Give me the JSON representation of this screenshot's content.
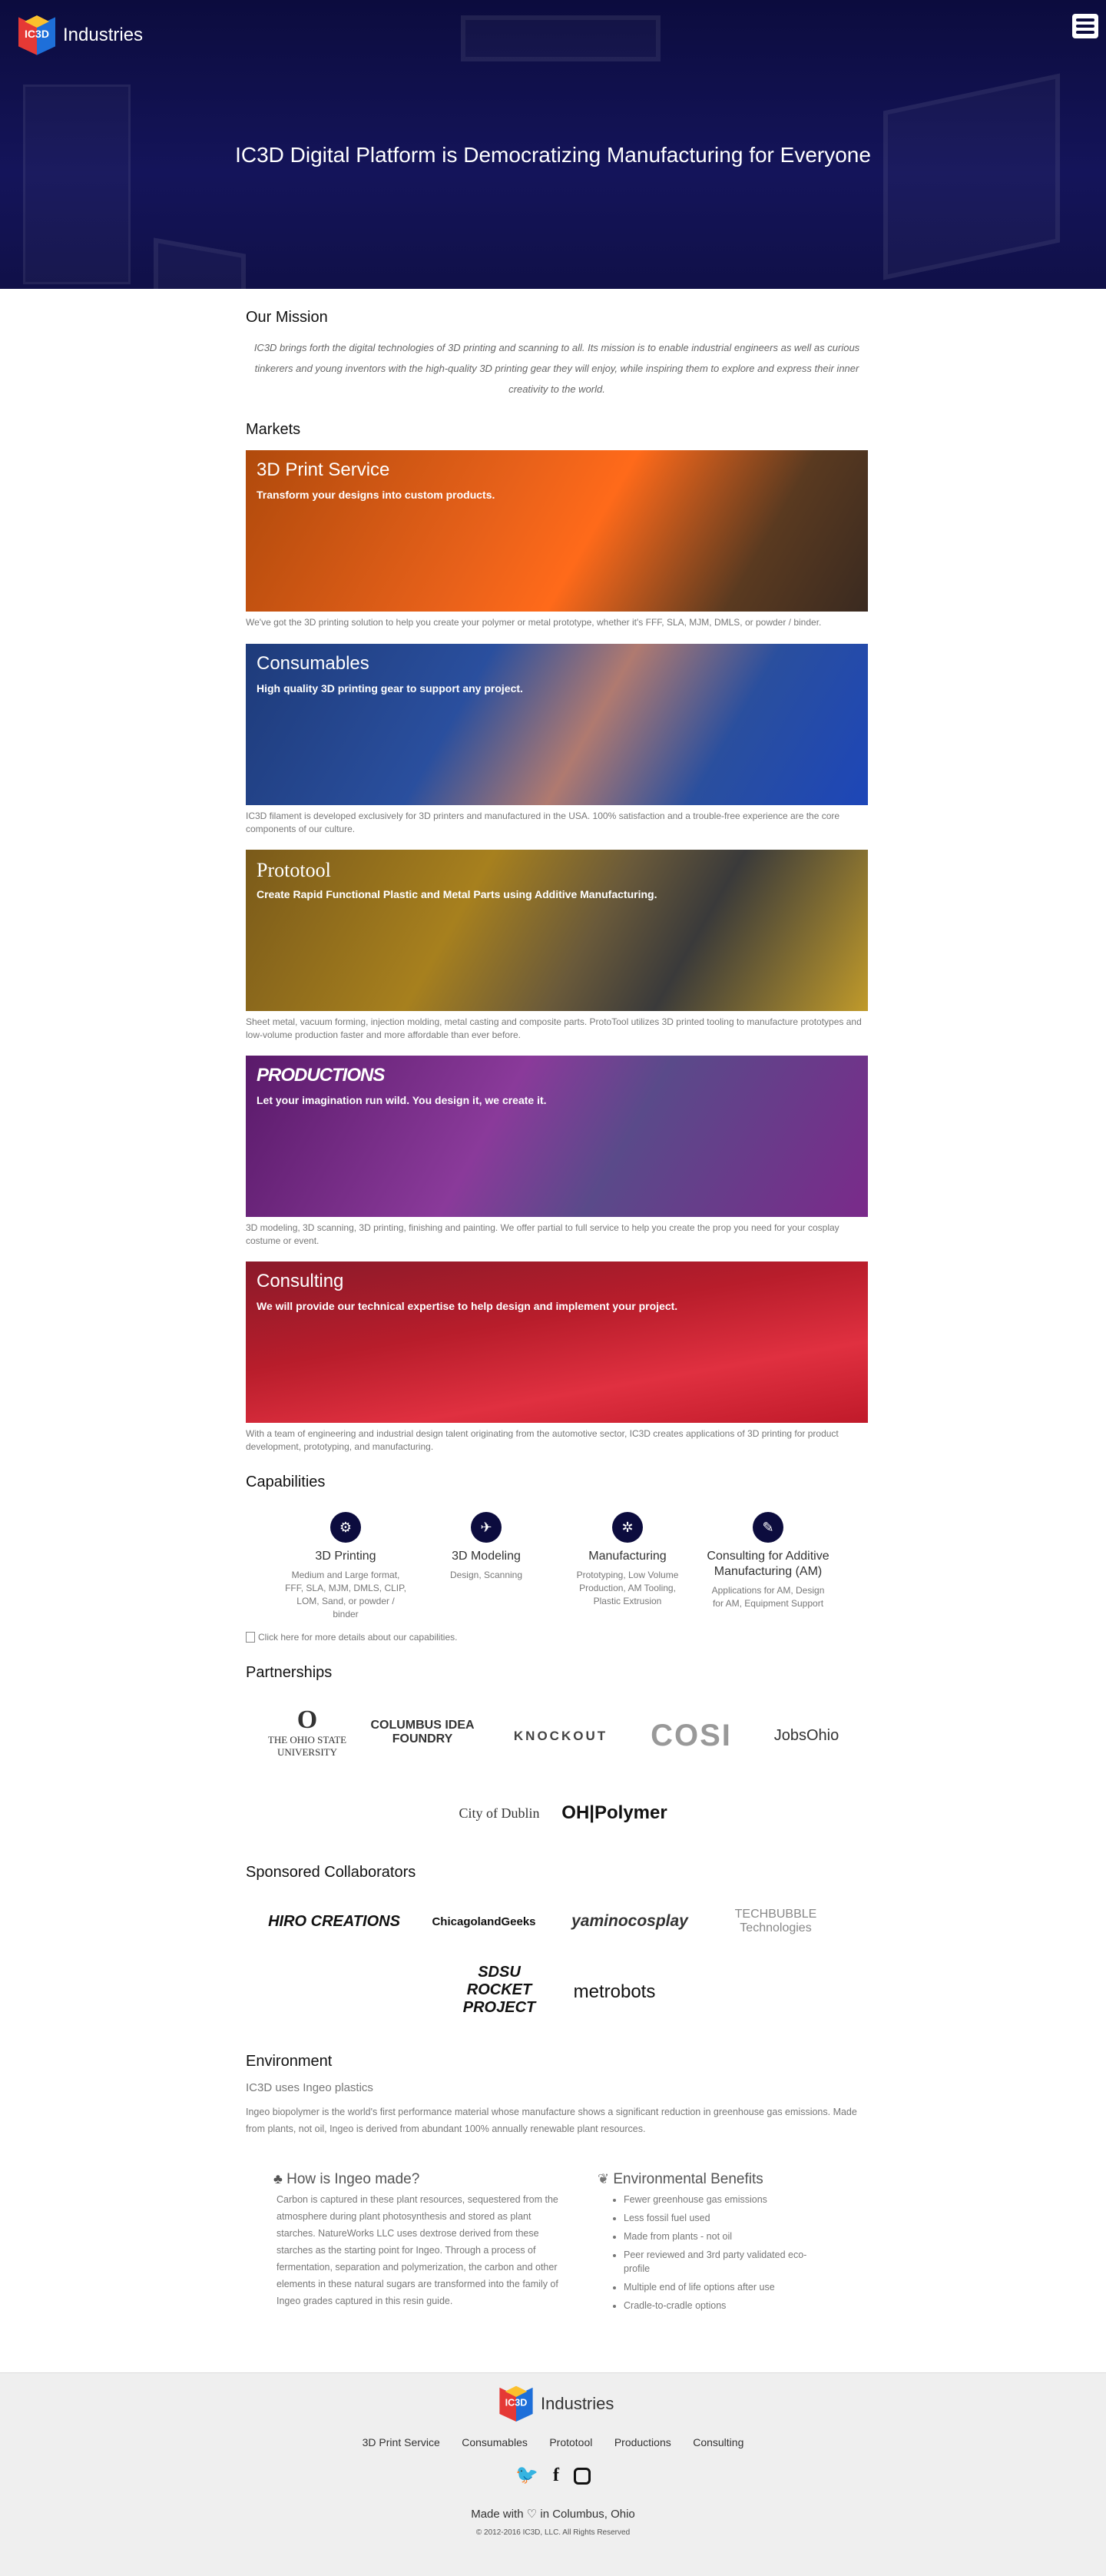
{
  "header": {
    "brand_glyph": "IC3D",
    "brand_text": "Industries",
    "hero_title": "IC3D Digital Platform is Democratizing Manufacturing for Everyone",
    "menu_icon": "hamburger-icon"
  },
  "mission": {
    "title": "Our Mission",
    "text": "IC3D brings forth the digital technologies of 3D printing and scanning to all. Its mission is to enable industrial engineers as well as curious tinkerers and young inventors with the high-quality 3D printing gear they will enjoy, while inspiring them to explore and express their inner creativity to the world."
  },
  "markets": {
    "title": "Markets",
    "items": [
      {
        "title": "3D Print Service",
        "subtitle": "Transform your designs into custom products.",
        "desc": "We've got the 3D printing solution to help you create your polymer or metal prototype, whether it's FFF, SLA, MJM, DMLS, or powder / binder.",
        "color": "#e8611a"
      },
      {
        "title": "Consumables",
        "subtitle": "High quality 3D printing gear to support any project.",
        "desc": "IC3D filament is developed exclusively for 3D printers and manufactured in the USA. 100% satisfaction and a trouble-free experience are the core components of our culture.",
        "color": "#2a4f9e"
      },
      {
        "title": "Prototool",
        "subtitle": "Create Rapid Functional Plastic and Metal Parts using Additive Manufacturing.",
        "desc": "Sheet metal, vacuum forming, injection molding, metal casting and composite parts. ProtoTool utilizes 3D printed tooling to manufacture prototypes and low-volume production faster and more affordable than ever before.",
        "color": "#a7801e"
      },
      {
        "title": "PRODUCTIONS",
        "subtitle": "Let your imagination run wild. You design it, we create it.",
        "desc": "3D modeling, 3D scanning, 3D printing, finishing and painting. We offer partial to full service to help you create the prop you need for your cosplay costume or event.",
        "color": "#7a2a8a"
      },
      {
        "title": "Consulting",
        "subtitle": "We will provide our technical expertise to help design and implement your project.",
        "desc": "With a team of engineering and industrial design talent originating from the automotive sector, IC3D creates applications of 3D printing for product development, prototyping, and manufacturing.",
        "color": "#b81d2b"
      }
    ]
  },
  "capabilities": {
    "title": "Capabilities",
    "items": [
      {
        "icon": "printer-icon",
        "title": "3D Printing",
        "desc": "Medium and Large format, FFF, SLA, MJM, DMLS, CLIP, LOM, Sand, or powder / binder"
      },
      {
        "icon": "cube-icon",
        "title": "3D Modeling",
        "desc": "Design, Scanning"
      },
      {
        "icon": "gear-icon",
        "title": "Manufacturing",
        "desc": "Prototyping, Low Volume Production, AM Tooling, Plastic Extrusion"
      },
      {
        "icon": "wrench-icon",
        "title": "Consulting for Additive Manufacturing (AM)",
        "desc": "Applications for AM, Design for AM, Equipment Support"
      }
    ],
    "link_text": "Click here for more details about our capabilities."
  },
  "partnerships": {
    "title": "Partnerships",
    "items": [
      "THE OHIO STATE UNIVERSITY",
      "COLUMBUS IDEA FOUNDRY",
      "KNOCKOUT",
      "COSI",
      "JobsOhio",
      "City of Dublin",
      "OH|Polymer"
    ]
  },
  "collaborators": {
    "title": "Sponsored Collaborators",
    "items": [
      "HIRO CREATIONS",
      "ChicagolandGeeks",
      "yaminocosplay",
      "TECHBUBBLE Technologies",
      "SDSU ROCKET PROJECT",
      "metrobots"
    ]
  },
  "environment": {
    "title": "Environment",
    "subtitle": "IC3D uses Ingeo plastics",
    "text": "Ingeo biopolymer is the world's first performance material whose manufacture shows a significant reduction in greenhouse gas emissions. Made from plants, not oil, Ingeo is derived from abundant 100% annually renewable plant resources.",
    "how_title": "How is Ingeo made?",
    "how_text": "Carbon is captured in these plant resources, sequestered from the atmosphere during plant photosynthesis and stored as plant starches. NatureWorks LLC uses dextrose derived from these starches as the starting point for Ingeo. Through a process of fermentation, separation and polymerization, the carbon and other elements in these natural sugars are transformed into the family of Ingeo grades captured in this resin guide.",
    "benefits_title": "Environmental Benefits",
    "benefits": [
      "Fewer greenhouse gas emissions",
      "Less fossil fuel used",
      "Made from plants - not oil",
      "Peer reviewed and 3rd party validated eco-profile",
      "Multiple end of life options after use",
      "Cradle-to-cradle options"
    ]
  },
  "footer": {
    "brand_text": "Industries",
    "nav": [
      "3D Print Service",
      "Consumables",
      "Prototool",
      "Productions",
      "Consulting"
    ],
    "made_with_prefix": "Made with",
    "made_with_suffix": "in Columbus, Ohio",
    "copyright": "© 2012-2016 IC3D, LLC. All Rights Reserved"
  }
}
